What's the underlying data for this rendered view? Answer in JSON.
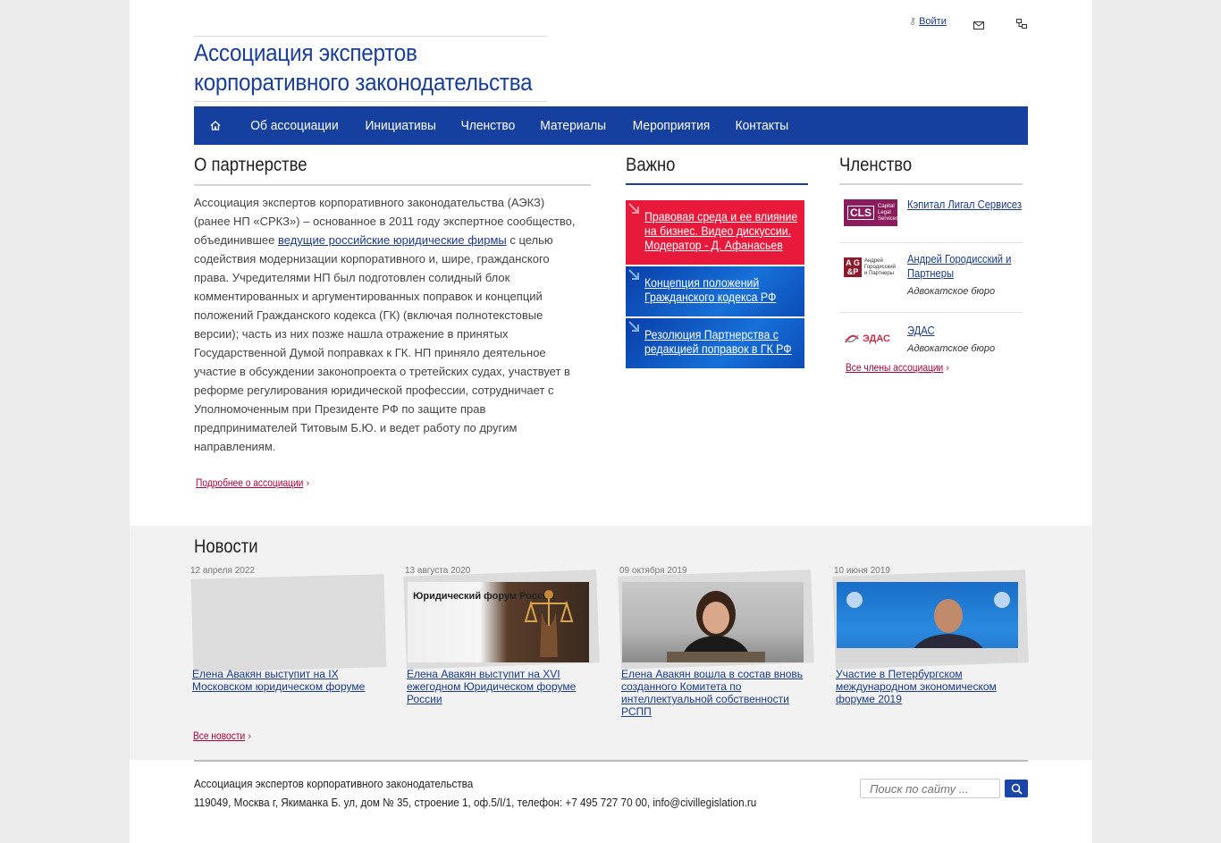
{
  "header": {
    "login_label": "Войти",
    "logo_line1": "Ассоциация экспертов",
    "logo_line2": "корпоративного законодательства"
  },
  "nav": {
    "items": [
      "Об ассоциации",
      "Инициативы",
      "Членство",
      "Материалы",
      "Мероприятия",
      "Контакты"
    ]
  },
  "about": {
    "title": "О партнерстве",
    "text_before_link": "Ассоциация экспертов корпоративного законодательства (АЭКЗ) (ранее НП «СРКЗ») – основанное в 2011 году экспертное сообщество, объединившее ",
    "link": "ведущие российские юридические фирмы",
    "text_after_link": " с целью содействия модернизации корпоративного и, шире, гражданского права. Учредителями НП был подготовлен солидный блок комментированных и аргументированных поправок и концепций положений Гражданского кодекса (ГК) (включая полнотекстовые версии); часть из них позже нашла отражение в принятых Государственной Думой поправках к ГК. НП приняло деятельное участие в обсуждении законопроекта о третейских судах, участвует в реформе регулирования юридической профессии, сотрудничает с Уполномоченным при Президенте РФ по защите прав предпринимателей Титовым Б.Ю. и ведет работу по другим направлениям.",
    "more_link": "Подробнее о ассоциации"
  },
  "important": {
    "title": "Важно",
    "items": [
      {
        "text": "Правовая среда и ее влияние на бизнес. Видео дискуссии. Модератор - Д. Афанасьев",
        "color": "#e8193a"
      },
      {
        "text": "Концепция положений Гражданского кодекса РФ",
        "color": "#1060c8"
      },
      {
        "text": "Резолюция Партнерства с редакцией поправок в ГК РФ",
        "color": "#1060c8"
      }
    ]
  },
  "membership": {
    "title": "Членство",
    "members": [
      {
        "name": "Кэпитал Лигал Сервисез",
        "type": "",
        "logo_text": "Capital Legal Services"
      },
      {
        "name": "Андрей Городисский и Партнеры",
        "type": "Адвокатское бюро",
        "logo_text": "Андрей Городисский и Партнеры"
      },
      {
        "name": "ЭДАС",
        "type": "Адвокатское бюро",
        "logo_text": "ЭДАС"
      }
    ],
    "all_link": "Все члены ассоциации"
  },
  "news": {
    "title": "Новости",
    "items": [
      {
        "date": "12 апреля 2022",
        "title": "Елена Авакян выступит на IX Московском юридическом форуме"
      },
      {
        "date": "13 августа 2020",
        "title": "Елена Авакян выступит на XVI ежегодном Юридическом форуме России",
        "image_text": "Юридический форум России"
      },
      {
        "date": "09 октября 2019",
        "title": "Елена Авакян вошла в состав вновь созданного Комитета по интеллектуальной собственности РСПП"
      },
      {
        "date": "10 июня 2019",
        "title": "Участие в Петербургском международном экономическом форуме 2019"
      }
    ],
    "all_link": "Все новости"
  },
  "footer": {
    "org_name": "Ассоциация экспертов корпоративного законодательства",
    "address": "119049, Москва г, Якиманка Б. ул, дом № 35, строение 1, оф.5/I/1, телефон: +7 495 727 70 00, info@civillegislation.ru",
    "search_placeholder": "Поиск по сайту ..."
  },
  "colors": {
    "brand_blue": "#1640a0",
    "accent_red": "#e8193a",
    "link_red": "#b0003a"
  }
}
